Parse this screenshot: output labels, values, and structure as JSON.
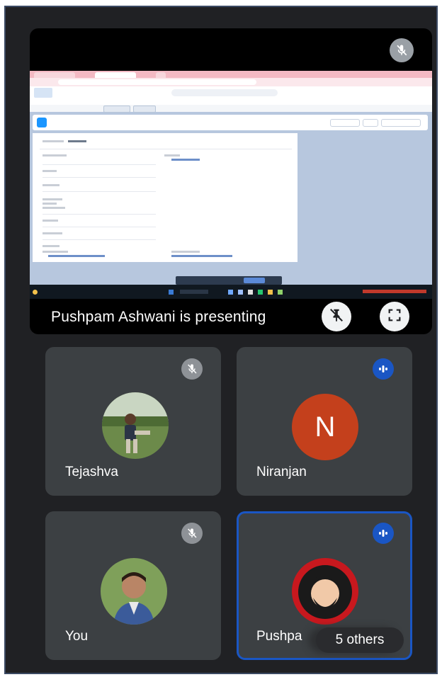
{
  "presentation": {
    "caption": "Pushpam Ashwani is presenting",
    "icons": {
      "mic_off": "mic-off-icon",
      "unpin": "unpin-icon",
      "fullscreen": "fullscreen-icon"
    }
  },
  "participants": [
    {
      "name": "Tejashva",
      "avatar": "photo",
      "status": "muted"
    },
    {
      "name": "Niranjan",
      "avatar": "letter",
      "initial": "N",
      "status": "speaking"
    },
    {
      "name": "You",
      "avatar": "photo",
      "status": "muted"
    },
    {
      "name": "Pushpa",
      "avatar": "photo",
      "status": "speaking",
      "active": true
    }
  ],
  "others_label": "5 others",
  "colors": {
    "background": "#202124",
    "tile": "#3c4043",
    "accent_blue": "#1a56c4",
    "avatar_orange": "#c4401c"
  }
}
